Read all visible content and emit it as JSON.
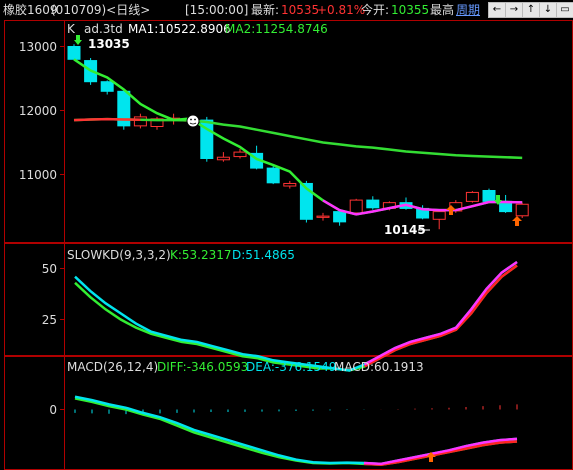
{
  "header": {
    "symbol": "橡胶1609",
    "code_period": "(010709)<日线>",
    "time": "[15:00:00]",
    "latest_label": "最新:",
    "latest_value": "10535",
    "change_pct": "+0.81%",
    "open_label": "今开:",
    "open_value": "10355",
    "high_label": "最高",
    "period_link": "周期",
    "buttons": [
      "←",
      "→",
      "↑",
      "↓",
      "▭"
    ]
  },
  "colors": {
    "up": "#ff3333",
    "down": "#00e5ee",
    "ma1": "#ffffff",
    "ma2": "#33ee33",
    "border": "#b00000",
    "tick": "#b00000"
  },
  "panels": {
    "price": {
      "legend": {
        "k": "K",
        "ad": "ad.3td",
        "ma1": "MA1:10522.8906",
        "ma2": "MA2:11254.8746"
      },
      "yticks": [
        "13000",
        "12000",
        "11000"
      ],
      "annot_high": "13035",
      "annot_low": "10145"
    },
    "kd": {
      "legend": {
        "name": "SLOWKD(9,3,3,2)",
        "k": "K:53.2317",
        "d": "D:51.4865"
      },
      "yticks": [
        "50",
        "25"
      ]
    },
    "macd": {
      "legend": {
        "name": "MACD(26,12,4)",
        "diff": "DIFF:-346.0593",
        "dea": "DEA:-376.1549",
        "macd": "MACD:60.1913"
      },
      "yticks": [
        "0"
      ]
    }
  },
  "chart_data": [
    {
      "type": "candlestick",
      "title": "",
      "ylim": [
        10000,
        13200
      ],
      "candles": [
        {
          "o": 13000,
          "h": 13035,
          "l": 12800,
          "c": 12800
        },
        {
          "o": 12780,
          "h": 12820,
          "l": 12400,
          "c": 12450
        },
        {
          "o": 12450,
          "h": 12470,
          "l": 12250,
          "c": 12300
        },
        {
          "o": 12300,
          "h": 12320,
          "l": 11700,
          "c": 11760
        },
        {
          "o": 11760,
          "h": 11950,
          "l": 11720,
          "c": 11900
        },
        {
          "o": 11750,
          "h": 11900,
          "l": 11700,
          "c": 11870
        },
        {
          "o": 11870,
          "h": 11950,
          "l": 11780,
          "c": 11880
        },
        {
          "o": 11850,
          "h": 11920,
          "l": 11800,
          "c": 11850
        },
        {
          "o": 11850,
          "h": 11900,
          "l": 11200,
          "c": 11250
        },
        {
          "o": 11230,
          "h": 11350,
          "l": 11200,
          "c": 11270
        },
        {
          "o": 11280,
          "h": 11400,
          "l": 11250,
          "c": 11350
        },
        {
          "o": 11330,
          "h": 11450,
          "l": 11080,
          "c": 11100
        },
        {
          "o": 11100,
          "h": 11150,
          "l": 10850,
          "c": 10870
        },
        {
          "o": 10820,
          "h": 10900,
          "l": 10780,
          "c": 10860
        },
        {
          "o": 10860,
          "h": 10900,
          "l": 10250,
          "c": 10300
        },
        {
          "o": 10330,
          "h": 10400,
          "l": 10280,
          "c": 10350
        },
        {
          "o": 10420,
          "h": 10450,
          "l": 10200,
          "c": 10260
        },
        {
          "o": 10400,
          "h": 10620,
          "l": 10380,
          "c": 10600
        },
        {
          "o": 10600,
          "h": 10660,
          "l": 10450,
          "c": 10480
        },
        {
          "o": 10470,
          "h": 10580,
          "l": 10440,
          "c": 10560
        },
        {
          "o": 10560,
          "h": 10640,
          "l": 10450,
          "c": 10470
        },
        {
          "o": 10470,
          "h": 10520,
          "l": 10300,
          "c": 10320
        },
        {
          "o": 10300,
          "h": 10450,
          "l": 10145,
          "c": 10420
        },
        {
          "o": 10430,
          "h": 10600,
          "l": 10400,
          "c": 10560
        },
        {
          "o": 10580,
          "h": 10740,
          "l": 10560,
          "c": 10720
        },
        {
          "o": 10750,
          "h": 10780,
          "l": 10550,
          "c": 10580
        },
        {
          "o": 10580,
          "h": 10680,
          "l": 10400,
          "c": 10420
        },
        {
          "o": 10355,
          "h": 10560,
          "l": 10320,
          "c": 10535
        }
      ],
      "ma1": [
        11850,
        11860,
        11865,
        11860,
        11855,
        11850,
        11850,
        11845,
        11820,
        11780,
        11750,
        11700,
        11650,
        11600,
        11550,
        11500,
        11470,
        11440,
        11420,
        11390,
        11360,
        11340,
        11320,
        11300,
        11290,
        11280,
        11270,
        11260
      ]
    },
    {
      "type": "line",
      "title": "",
      "ylim": [
        0,
        60
      ],
      "series_values": {
        "k": [
          46,
          39,
          33,
          28,
          23,
          19,
          17,
          15,
          14,
          12,
          10,
          8,
          7,
          5,
          4,
          3,
          2,
          1,
          0,
          3,
          7,
          11,
          14,
          16,
          18,
          21,
          30,
          40,
          48,
          53.2
        ],
        "d": [
          43,
          36,
          30,
          25,
          21,
          18,
          16,
          14,
          13,
          11,
          9,
          7,
          6,
          4,
          3,
          2,
          1,
          1,
          0,
          2,
          6,
          10,
          13,
          15,
          17,
          20,
          28,
          38,
          46,
          51.5
        ]
      }
    },
    {
      "type": "line",
      "title": "",
      "ylim": [
        -700,
        300
      ],
      "series_values": {
        "diff": [
          150,
          110,
          60,
          20,
          -40,
          -90,
          -160,
          -240,
          -300,
          -360,
          -420,
          -480,
          -540,
          -590,
          -620,
          -630,
          -625,
          -630,
          -640,
          -600,
          -560,
          -520,
          -480,
          -430,
          -390,
          -360,
          -346
        ],
        "dea": [
          130,
          90,
          40,
          0,
          -60,
          -110,
          -190,
          -270,
          -330,
          -390,
          -450,
          -510,
          -560,
          -600,
          -630,
          -635,
          -630,
          -640,
          -650,
          -620,
          -580,
          -540,
          -500,
          -460,
          -420,
          -390,
          -376
        ],
        "macd_hist": [
          -40,
          -45,
          -50,
          -55,
          -50,
          -45,
          -40,
          -35,
          -30,
          -30,
          -28,
          -25,
          -22,
          -18,
          -14,
          -10,
          -6,
          -3,
          2,
          5,
          10,
          15,
          20,
          30,
          40,
          50,
          60
        ]
      }
    }
  ]
}
